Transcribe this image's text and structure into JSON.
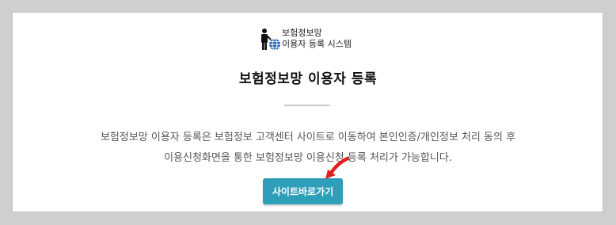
{
  "logo": {
    "line1": "보험정보망",
    "line2": "이용자 등록 시스템",
    "icon": "person-globe-icon"
  },
  "title": "보험정보망 이용자 등록",
  "description": {
    "line1": "보험정보망 이용자 등록은 보험정보 고객센터 사이트로 이동하여 본인인증/개인정보 처리 동의 후",
    "line2": "이용신청화면을 통한 보험정보망 이용신청 등록 처리가 가능합니다."
  },
  "button": {
    "label": "사이트바로가기"
  },
  "colors": {
    "accent": "#2e9fb9",
    "annotation_arrow": "#e0201e"
  }
}
